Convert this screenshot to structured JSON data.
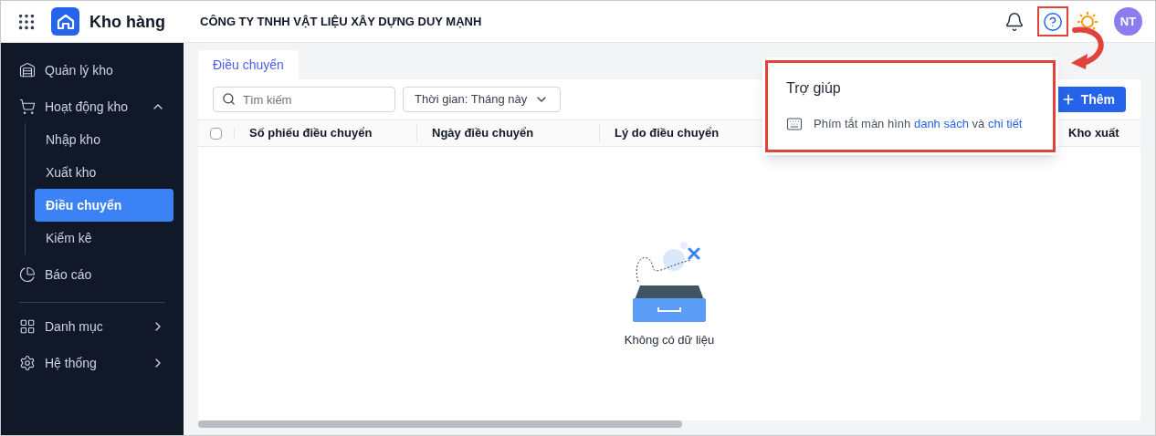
{
  "header": {
    "app_name": "Kho hàng",
    "company": "CÔNG TY TNHH VẬT LIỆU XÂY DỰNG DUY MẠNH",
    "avatar": "NT",
    "help_highlighted": true
  },
  "sidebar": {
    "items": [
      {
        "kind": "item",
        "label": "Quản lý kho"
      },
      {
        "kind": "group",
        "label": "Hoạt động kho",
        "expanded": true,
        "children": [
          {
            "label": "Nhập kho",
            "selected": false
          },
          {
            "label": "Xuất kho",
            "selected": false
          },
          {
            "label": "Điều chuyển",
            "selected": true
          },
          {
            "label": "Kiểm kê",
            "selected": false
          }
        ]
      },
      {
        "kind": "item",
        "label": "Báo cáo"
      },
      {
        "kind": "divider"
      },
      {
        "kind": "group",
        "label": "Danh mục",
        "expanded": false
      },
      {
        "kind": "group",
        "label": "Hệ thống",
        "expanded": false
      }
    ]
  },
  "tabs": [
    {
      "label": "Điều chuyển",
      "selected": true
    }
  ],
  "toolbar": {
    "search": {
      "placeholder": "Tìm kiếm"
    },
    "period_filter": "Thời gian: Tháng này",
    "add_button": "Thêm"
  },
  "table": {
    "select_all_checked": false,
    "columns": [
      "Số phiếu điều chuyển",
      "Ngày điều chuyển",
      "Lý do điều chuyển",
      "Kho xuất"
    ],
    "empty_text": "Không có dữ liệu"
  },
  "help_popover": {
    "title": "Trợ giúp",
    "text_parts": [
      {
        "kind": "text",
        "text": "Phím tắt màn hình "
      },
      {
        "kind": "link",
        "text": "danh sách"
      },
      {
        "kind": "text",
        "text": " và "
      },
      {
        "kind": "link",
        "text": "chi tiết"
      }
    ]
  }
}
